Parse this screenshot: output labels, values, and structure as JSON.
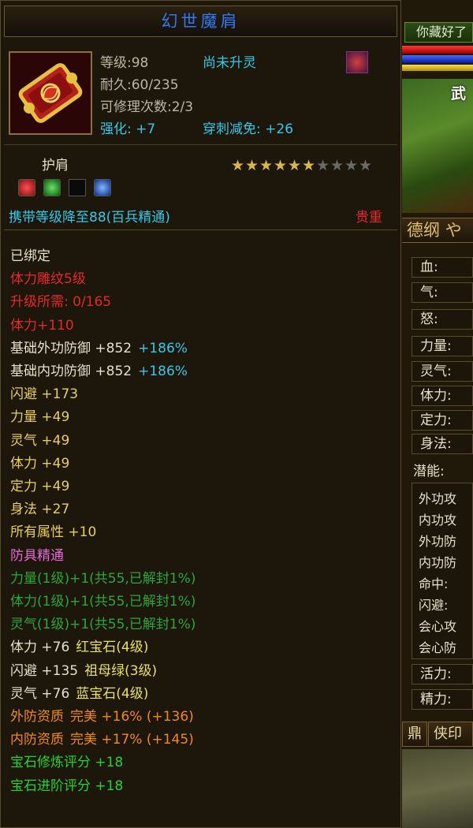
{
  "item": {
    "name": "幻世魔肩",
    "level": "等级:98",
    "spirit": "尚未升灵",
    "durability": "耐久:60/235",
    "repair": "可修理次数:2/3",
    "enhance": "强化: +7",
    "pierce": "穿刺减免: +26",
    "type": "护肩",
    "stars_total": 10,
    "stars_lit": 6,
    "carry": "携带等级降至88(百兵精通)",
    "rarity": "贵重"
  },
  "icons": [
    "ruby-gem-icon",
    "emerald-gem-icon",
    "empty-gem-slot",
    "sapphire-gem-icon"
  ],
  "attributes": [
    {
      "text": "已绑定",
      "color": "w"
    },
    {
      "text": "体力雕纹5级",
      "color": "red"
    },
    {
      "text": "升级所需: 0/165",
      "color": "red"
    },
    {
      "text": "体力+110",
      "color": "red"
    },
    {
      "text": "基础外功防御 +852",
      "extra": "+186%",
      "color": "w"
    },
    {
      "text": "基础内功防御 +852",
      "extra": "+186%",
      "color": "w"
    },
    {
      "text": "闪避 +173",
      "color": "y2"
    },
    {
      "text": "力量 +49",
      "color": "y2"
    },
    {
      "text": "灵气 +49",
      "color": "y2"
    },
    {
      "text": "体力 +49",
      "color": "y2"
    },
    {
      "text": "定力 +49",
      "color": "y2"
    },
    {
      "text": "身法 +27",
      "color": "y2"
    },
    {
      "text": "所有属性 +10",
      "color": "y2"
    },
    {
      "text": "防具精通",
      "color": "pink"
    },
    {
      "text": "力量(1级)+1(共55,已解封1%)",
      "color": "dg"
    },
    {
      "text": "体力(1级)+1(共55,已解封1%)",
      "color": "dg"
    },
    {
      "text": "灵气(1级)+1(共55,已解封1%)",
      "color": "dg"
    },
    {
      "text": "体力 +76",
      "extra": "红宝石(4级)",
      "color": "w"
    },
    {
      "text": "闪避 +135",
      "extra": "祖母绿(3级)",
      "color": "w"
    },
    {
      "text": "灵气 +76",
      "extra": "蓝宝石(4级)",
      "color": "w"
    },
    {
      "text": "外防资质",
      "extra": "完美 +16% (+136)",
      "color": "or"
    },
    {
      "text": "内防资质",
      "extra": "完美 +17% (+145)",
      "color": "or"
    },
    {
      "text": "宝石修炼评分 +18",
      "color": "br"
    },
    {
      "text": "宝石进阶评分 +18",
      "color": "br"
    }
  ],
  "side": {
    "greeting": "你藏好了",
    "scene_text": "武",
    "moral": "德纲 や",
    "stats": [
      "血:",
      "气:",
      "怒:",
      "力量:",
      "灵气:",
      "体力:",
      "定力:",
      "身法:"
    ],
    "latent": "潜能:",
    "latent_items": [
      "外功攻",
      "内功攻",
      "外功防",
      "内功防",
      "命中:",
      "闪避:",
      "会心攻",
      "会心防"
    ],
    "extra_stats": [
      "活力:",
      "精力:"
    ],
    "buttons": [
      "鼎",
      "侠印"
    ]
  },
  "colors": {
    "title": "#3a78e0",
    "cyan": "#35c8e8",
    "red": "#e42a2a",
    "orange": "#f08a1c",
    "green": "#29d22c",
    "star_lit": "#d8b84a",
    "star_dim": "#6a6a6a"
  }
}
